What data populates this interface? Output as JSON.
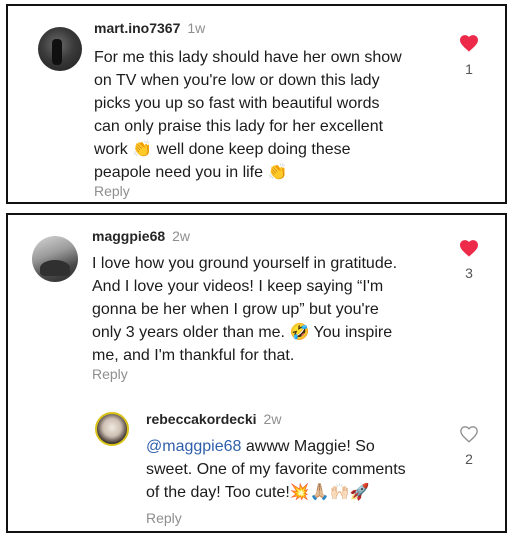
{
  "colors": {
    "heart_liked": "#ed2a4a",
    "mention": "#2f5faa",
    "muted": "#8e8e8e"
  },
  "comments": [
    {
      "username": "mart.ino7367",
      "time": "1w",
      "lines": [
        "For me this lady should have her own show",
        "on TV when you're low or down this lady",
        "picks you up so fast with beautiful words",
        "can only praise this lady for her excellent",
        "work 👏 well done keep doing these",
        "peapole need you in life 👏"
      ],
      "reply_label": "Reply",
      "like_count": "1",
      "liked": true
    },
    {
      "username": "maggpie68",
      "time": "2w",
      "lines": [
        "I love how you ground yourself in gratitude.",
        "And I love your videos! I keep saying “I'm",
        "gonna be her when I grow up” but you're",
        "only 3 years older than me. 🤣 You inspire",
        "me, and I'm thankful for that."
      ],
      "reply_label": "Reply",
      "like_count": "3",
      "liked": true,
      "replies": [
        {
          "username": "rebeccakordecki",
          "time": "2w",
          "mention": "@maggpie68",
          "lines": [
            " awww Maggie! So",
            "sweet. One of my favorite comments",
            "of the day! Too cute!💥🙏🏼🙌🏻🚀"
          ],
          "reply_label": "Reply",
          "like_count": "2",
          "liked": false
        }
      ]
    }
  ]
}
